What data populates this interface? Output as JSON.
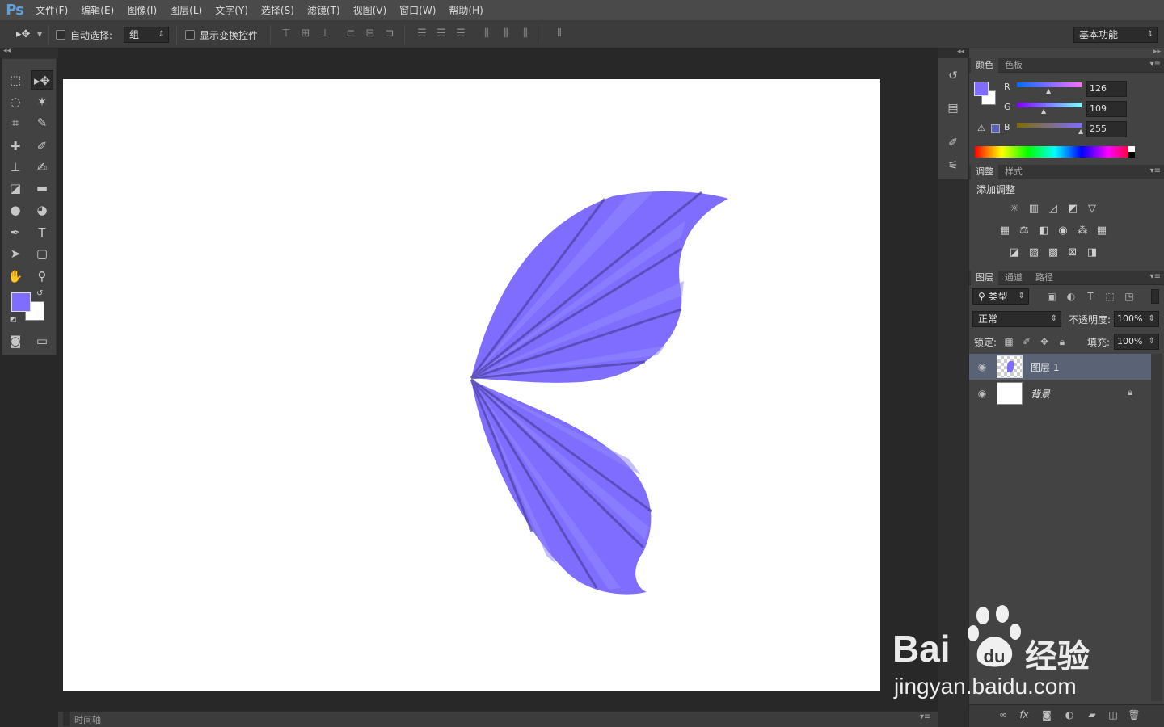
{
  "app": {
    "logo": "Ps"
  },
  "menu": [
    "文件(F)",
    "编辑(E)",
    "图像(I)",
    "图层(L)",
    "文字(Y)",
    "选择(S)",
    "滤镜(T)",
    "视图(V)",
    "窗口(W)",
    "帮助(H)"
  ],
  "options": {
    "auto_select_label": "自动选择:",
    "auto_select_value": "组",
    "show_transform_label": "显示变换控件",
    "workspace": "基本功能"
  },
  "color_panel": {
    "tabs": [
      "颜色",
      "色板"
    ],
    "foreground": "#7e6dff",
    "channels": [
      {
        "label": "R",
        "value": "126"
      },
      {
        "label": "G",
        "value": "109"
      },
      {
        "label": "B",
        "value": "255"
      }
    ]
  },
  "adjust_panel": {
    "tabs": [
      "调整",
      "样式"
    ],
    "title": "添加调整"
  },
  "layers_panel": {
    "tabs": [
      "图层",
      "通道",
      "路径"
    ],
    "filter_kind": "类型",
    "blend_mode": "正常",
    "opacity_label": "不透明度:",
    "opacity_value": "100%",
    "lock_label": "锁定:",
    "fill_label": "填充:",
    "fill_value": "100%",
    "layers": [
      {
        "name": "图层 1",
        "selected": true
      },
      {
        "name": "背景",
        "locked": true
      }
    ]
  },
  "timeline": {
    "label": "时间轴"
  },
  "watermark": {
    "brand": "Bai",
    "brand2": "经验",
    "url": "jingyan.baidu.com"
  },
  "colors": {
    "wing": "#7e6dff",
    "wing_dark": "#4f44a6",
    "selection": "#5a6375"
  }
}
